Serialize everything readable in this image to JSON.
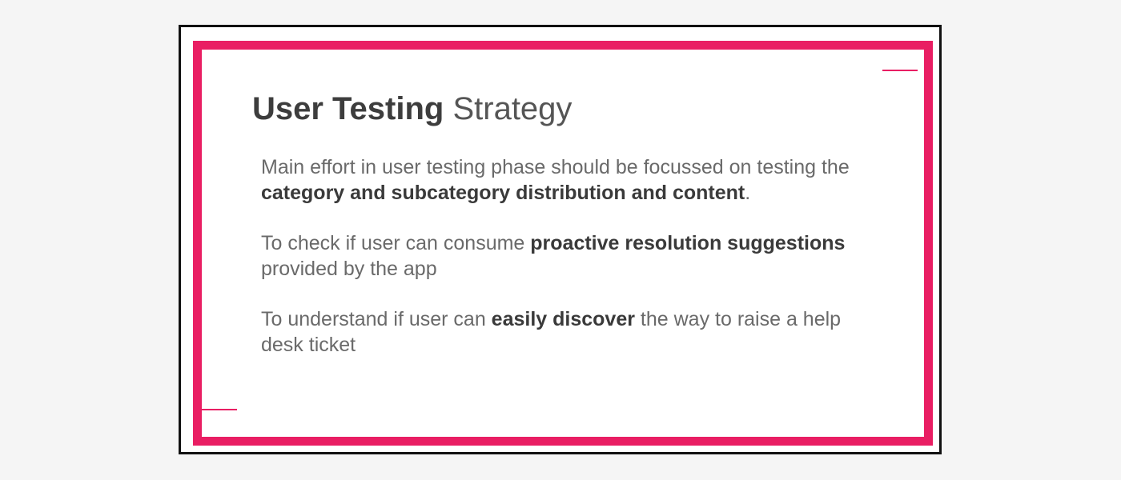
{
  "slide": {
    "title_bold": "User Testing",
    "title_light": "Strategy",
    "paragraphs": [
      {
        "pre": "Main effort in user testing phase should be focussed on testing the ",
        "bold": "category and subcategory distribution and content",
        "post": "."
      },
      {
        "pre": "To check if user can consume ",
        "bold": "proactive resolution suggestions",
        "post": " provided by the app"
      },
      {
        "pre": "To understand if user can ",
        "bold": "easily discover",
        "post": " the way to raise a help desk ticket"
      }
    ]
  },
  "colors": {
    "accent": "#e91e63",
    "border": "#111111",
    "background": "#f5f5f5"
  }
}
